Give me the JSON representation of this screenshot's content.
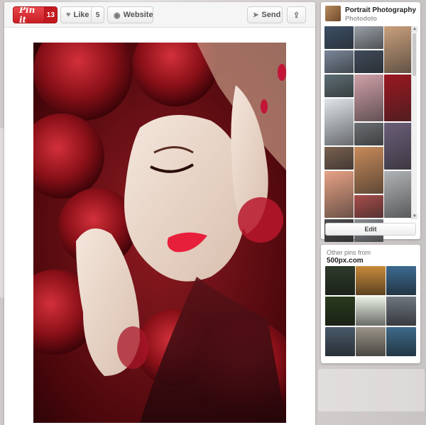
{
  "toolbar": {
    "pinit_label": "Pin it",
    "pin_count": "13",
    "like_label": "Like",
    "like_count": "5",
    "website_label": "Website",
    "send_label": "Send"
  },
  "board": {
    "title": "Portrait Photography",
    "owner": "Photodoto",
    "edit_label": "Edit",
    "tiles": [
      {
        "color": "#3b4e66",
        "tall": false
      },
      {
        "color": "#9aa0a8",
        "tall": false
      },
      {
        "color": "#c9a07c",
        "tall": true
      },
      {
        "color": "#7a8799",
        "tall": false
      },
      {
        "color": "#3f4a5a",
        "tall": false
      },
      {
        "color": "#5d6e74",
        "tall": false
      },
      {
        "color": "#cfa0a8",
        "tall": true
      },
      {
        "color": "#9b1720",
        "tall": true
      },
      {
        "color": "#dfe5ea",
        "tall": true
      },
      {
        "color": "#6c6f73",
        "tall": false
      },
      {
        "color": "#6a5e78",
        "tall": true
      },
      {
        "color": "#7a6150",
        "tall": false
      },
      {
        "color": "#c78a5a",
        "tall": true
      },
      {
        "color": "#e7a285",
        "tall": true
      },
      {
        "color": "#b1b4b6",
        "tall": true
      },
      {
        "color": "#a84d4a",
        "tall": false
      },
      {
        "color": "#4d4d4d",
        "tall": false
      },
      {
        "color": "#8a8d92",
        "tall": false
      }
    ]
  },
  "other": {
    "title": "Other pins from",
    "source": "500px.com",
    "tiles": [
      "#2d3a2a",
      "#c98a3a",
      "#3c6a8f",
      "#2a3a1e",
      "#e8efe3",
      "#6f7680",
      "#4a5a6a",
      "#9a9488",
      "#3d6a8a"
    ]
  }
}
